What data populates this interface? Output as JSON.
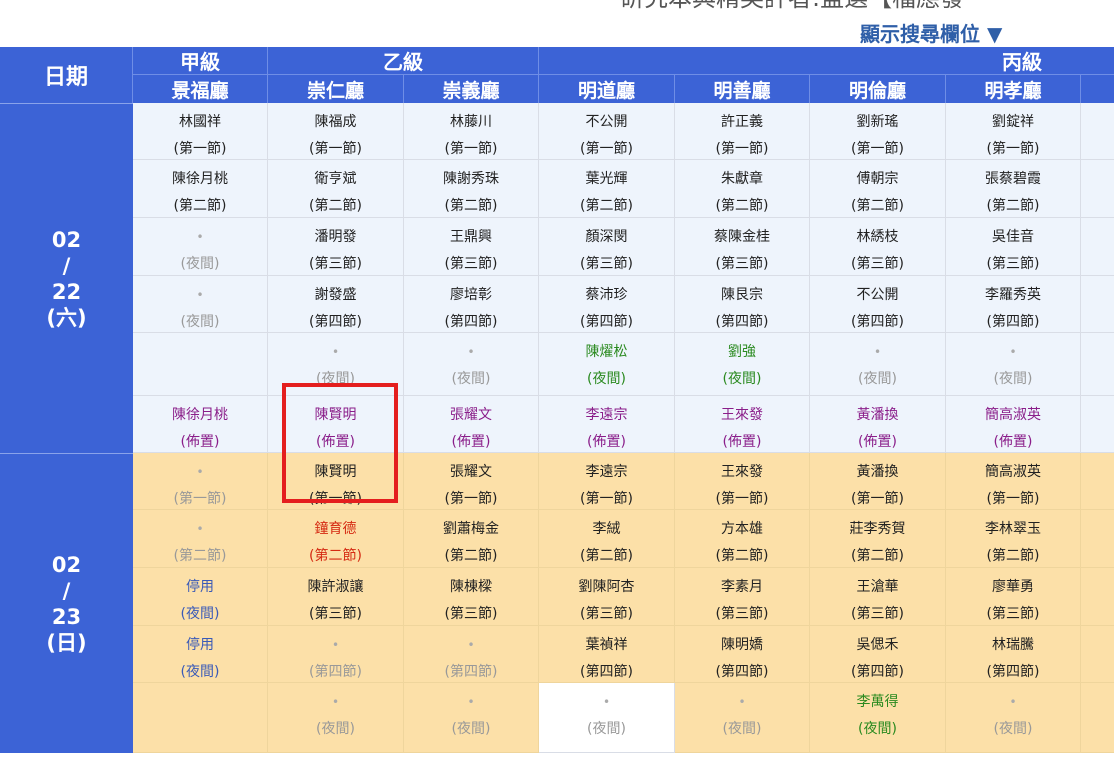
{
  "page": {
    "title_fragment": "研究本與精英評者:監選【檔應發",
    "toggle_label": "顯示搜尋欄位 ▼"
  },
  "header": {
    "date_label": "日期",
    "grades": [
      "甲級",
      "乙級",
      "丙級"
    ],
    "halls": [
      "景福廳",
      "崇仁廳",
      "崇義廳",
      "明道廳",
      "明善廳",
      "明倫廳",
      "明孝廳"
    ]
  },
  "days": [
    {
      "date": [
        "02",
        "/",
        "22",
        "(六)"
      ],
      "rows": [
        [
          [
            "林國祥",
            "(第一節)"
          ],
          [
            "陳福成",
            "(第一節)"
          ],
          [
            "林藤川",
            "(第一節)"
          ],
          [
            "不公開",
            "(第一節)"
          ],
          [
            "許正義",
            "(第一節)"
          ],
          [
            "劉新瑤",
            "(第一節)"
          ],
          [
            "劉錠祥",
            "(第一節)"
          ]
        ],
        [
          [
            "陳徐月桃",
            "(第二節)"
          ],
          [
            "衛亨斌",
            "(第二節)"
          ],
          [
            "陳謝秀珠",
            "(第二節)"
          ],
          [
            "葉光輝",
            "(第二節)"
          ],
          [
            "朱獻章",
            "(第二節)"
          ],
          [
            "傅朝宗",
            "(第二節)"
          ],
          [
            "張蔡碧霞",
            "(第二節)"
          ]
        ],
        [
          [
            "•",
            "(夜間)"
          ],
          [
            "潘明發",
            "(第三節)"
          ],
          [
            "王鼎興",
            "(第三節)"
          ],
          [
            "顏深閔",
            "(第三節)"
          ],
          [
            "蔡陳金桂",
            "(第三節)"
          ],
          [
            "林綉枝",
            "(第三節)"
          ],
          [
            "吳佳音",
            "(第三節)"
          ]
        ],
        [
          [
            "•",
            "(夜間)"
          ],
          [
            "謝發盛",
            "(第四節)"
          ],
          [
            "廖培彰",
            "(第四節)"
          ],
          [
            "蔡沛珍",
            "(第四節)"
          ],
          [
            "陳艮宗",
            "(第四節)"
          ],
          [
            "不公開",
            "(第四節)"
          ],
          [
            "李羅秀英",
            "(第四節)"
          ]
        ],
        [
          [
            "",
            ""
          ],
          [
            "•",
            "(夜間)"
          ],
          [
            "•",
            "(夜間)"
          ],
          [
            "陳燿松",
            "(夜間)"
          ],
          [
            "劉強",
            "(夜間)"
          ],
          [
            "•",
            "(夜間)"
          ],
          [
            "•",
            "(夜間)"
          ]
        ],
        [
          [
            "陳徐月桃",
            "(佈置)"
          ],
          [
            "陳賢明",
            "(佈置)"
          ],
          [
            "張耀文",
            "(佈置)"
          ],
          [
            "李遠宗",
            "(佈置)"
          ],
          [
            "王來發",
            "(佈置)"
          ],
          [
            "黃潘換",
            "(佈置)"
          ],
          [
            "簡高淑英",
            "(佈置)"
          ]
        ]
      ]
    },
    {
      "date": [
        "02",
        "/",
        "23",
        "(日)"
      ],
      "rows": [
        [
          [
            "•",
            "(第一節)"
          ],
          [
            "陳賢明",
            "(第一節)"
          ],
          [
            "張耀文",
            "(第一節)"
          ],
          [
            "李遠宗",
            "(第一節)"
          ],
          [
            "王來發",
            "(第一節)"
          ],
          [
            "黃潘換",
            "(第一節)"
          ],
          [
            "簡高淑英",
            "(第一節)"
          ]
        ],
        [
          [
            "•",
            "(第二節)"
          ],
          [
            "鐘育德",
            "(第二節)"
          ],
          [
            "劉蕭梅金",
            "(第二節)"
          ],
          [
            "李絨",
            "(第二節)"
          ],
          [
            "方本雄",
            "(第二節)"
          ],
          [
            "莊李秀賀",
            "(第二節)"
          ],
          [
            "李林翠玉",
            "(第二節)"
          ]
        ],
        [
          [
            "停用",
            "(夜間)"
          ],
          [
            "陳許淑讓",
            "(第三節)"
          ],
          [
            "陳棟樑",
            "(第三節)"
          ],
          [
            "劉陳阿杏",
            "(第三節)"
          ],
          [
            "李素月",
            "(第三節)"
          ],
          [
            "王滄華",
            "(第三節)"
          ],
          [
            "廖華勇",
            "(第三節)"
          ]
        ],
        [
          [
            "停用",
            "(夜間)"
          ],
          [
            "•",
            "(第四節)"
          ],
          [
            "•",
            "(第四節)"
          ],
          [
            "葉禎祥",
            "(第四節)"
          ],
          [
            "陳明嬌",
            "(第四節)"
          ],
          [
            "吳偲禾",
            "(第四節)"
          ],
          [
            "林瑞騰",
            "(第四節)"
          ]
        ],
        [
          [
            "",
            ""
          ],
          [
            "•",
            "(夜間)"
          ],
          [
            "•",
            "(夜間)"
          ],
          [
            "•",
            "(夜間)"
          ],
          [
            "•",
            "(夜間)"
          ],
          [
            "李萬得",
            "(夜間)"
          ],
          [
            "•",
            "(夜間)"
          ]
        ]
      ]
    }
  ],
  "colors": {
    "header_blue": "#3c63d6",
    "day1_bg": "#eef4fc",
    "day2_bg": "#fce0a8",
    "green": "#2a8a1f",
    "purple": "#8a1e8a",
    "red": "#d52a12",
    "highlight": "#e41e1e"
  }
}
